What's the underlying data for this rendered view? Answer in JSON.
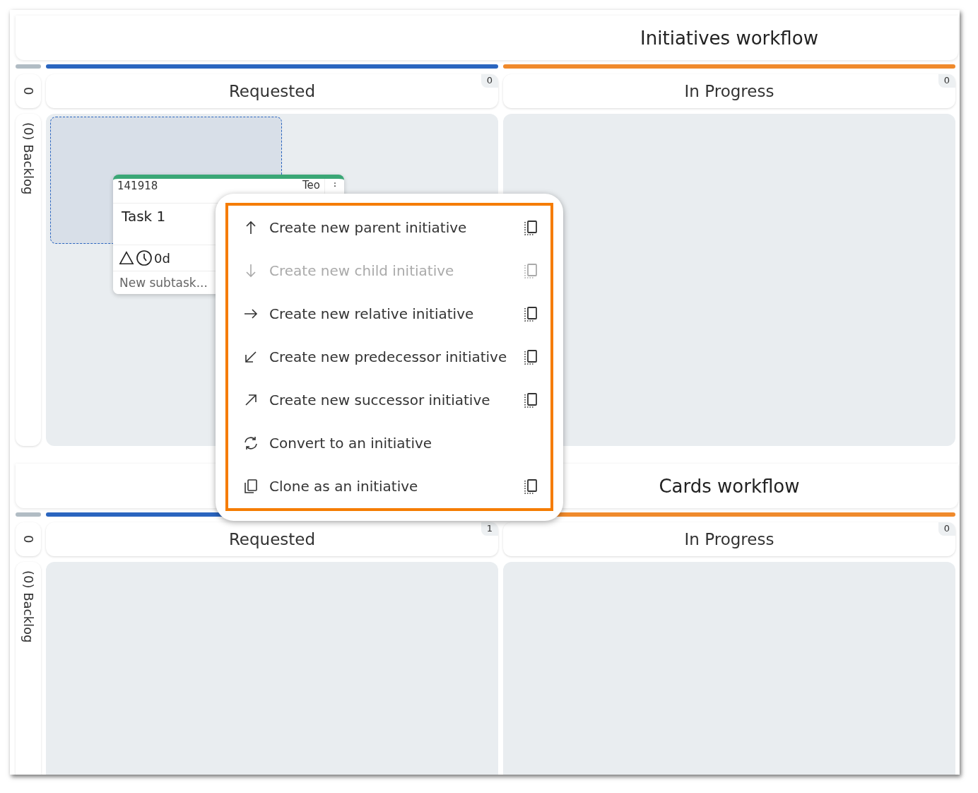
{
  "boards": [
    {
      "title": "Initiatives workflow",
      "lane": {
        "count": "0",
        "label": "(0) Backlog"
      },
      "columns": [
        {
          "name": "Requested",
          "count": "0",
          "color": "#2a65bf"
        },
        {
          "name": "In Progress",
          "count": "0",
          "color": "#f08a2c"
        }
      ],
      "card": {
        "id": "141918",
        "assignee": "Teo",
        "title": "Task 1",
        "duration": "0d",
        "placeholder": "New subtask...",
        "color": "#3aa776"
      }
    },
    {
      "title": "Cards workflow",
      "lane": {
        "count": "0",
        "label": "(0) Backlog"
      },
      "columns": [
        {
          "name": "Requested",
          "count": "1",
          "color": "#2a65bf"
        },
        {
          "name": "In Progress",
          "count": "0",
          "color": "#f08a2c"
        }
      ]
    }
  ],
  "context_menu": {
    "items": [
      {
        "label": "Create new parent initiative",
        "kind": "up",
        "disabled": false,
        "new_window": true
      },
      {
        "label": "Create new child initiative",
        "kind": "down",
        "disabled": true,
        "new_window": true
      },
      {
        "label": "Create new relative initiative",
        "kind": "right",
        "disabled": false,
        "new_window": true
      },
      {
        "label": "Create new predecessor initiative",
        "kind": "down-left",
        "disabled": false,
        "new_window": true
      },
      {
        "label": "Create new successor initiative",
        "kind": "up-right",
        "disabled": false,
        "new_window": true
      },
      {
        "label": "Convert to an initiative",
        "kind": "convert",
        "disabled": false,
        "new_window": false
      },
      {
        "label": "Clone as an initiative",
        "kind": "clone",
        "disabled": false,
        "new_window": true
      }
    ]
  }
}
